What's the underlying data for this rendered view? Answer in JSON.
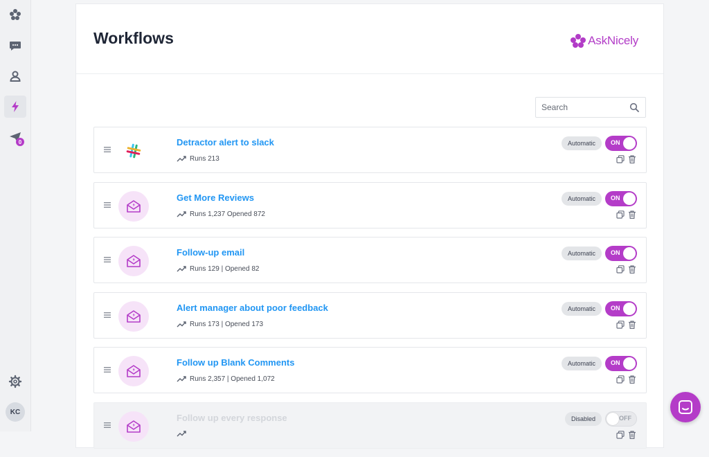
{
  "page": {
    "title": "Workflows"
  },
  "brand": {
    "name": "AskNicely",
    "color": "#b23cc7"
  },
  "search": {
    "placeholder": "Search"
  },
  "nav": {
    "items": [
      {
        "name": "dashboard",
        "icon": "flower-icon"
      },
      {
        "name": "responses",
        "icon": "chat-bubble-icon"
      },
      {
        "name": "contacts",
        "icon": "person-icon"
      },
      {
        "name": "workflows",
        "icon": "lightning-icon",
        "active": true
      },
      {
        "name": "send",
        "icon": "paper-plane-icon",
        "badge": "0"
      }
    ],
    "settings_icon": "gear-icon",
    "avatar_initials": "KC"
  },
  "workflows": [
    {
      "title": "Detractor alert to slack",
      "icon": "slack-icon",
      "stats": "Runs 213",
      "mode": "Automatic",
      "toggle": "ON"
    },
    {
      "title": "Get More Reviews",
      "icon": "email-icon",
      "stats": "Runs 1,237 Opened 872",
      "mode": "Automatic",
      "toggle": "ON"
    },
    {
      "title": "Follow-up email",
      "icon": "email-icon",
      "stats": "Runs 129 | Opened 82",
      "mode": "Automatic",
      "toggle": "ON"
    },
    {
      "title": "Alert manager about poor feedback",
      "icon": "email-icon",
      "stats": "Runs 173 | Opened 173",
      "mode": "Automatic",
      "toggle": "ON"
    },
    {
      "title": "Follow up Blank Comments",
      "icon": "email-icon",
      "stats": "Runs 2,357 | Opened 1,072",
      "mode": "Automatic",
      "toggle": "ON"
    },
    {
      "title": "Follow up every response",
      "icon": "email-icon",
      "stats": "",
      "mode": "Disabled",
      "toggle": "OFF"
    }
  ],
  "colors": {
    "accent": "#b43cc8",
    "link": "#2196f3"
  },
  "chat_widget": {
    "icon": "chat-launcher-icon"
  }
}
